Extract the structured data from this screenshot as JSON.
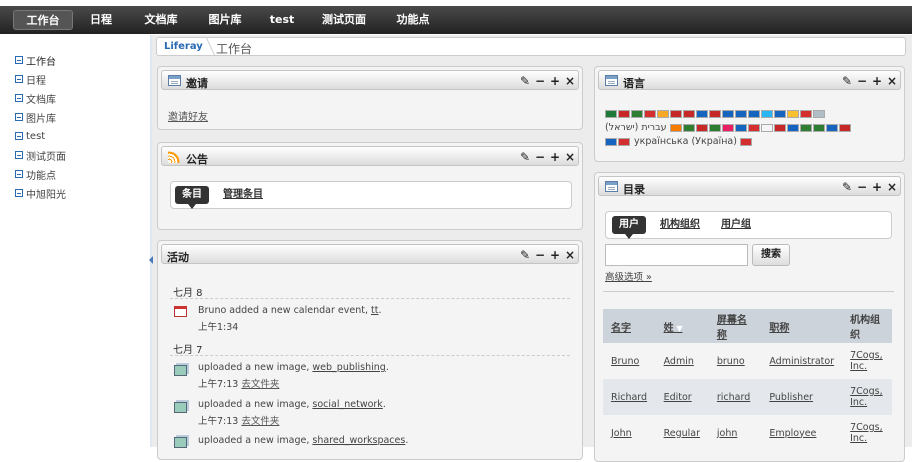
{
  "nav": {
    "items": [
      "工作台",
      "日程",
      "文档库",
      "图片库",
      "test",
      "测试页面",
      "功能点"
    ],
    "active": "工作台"
  },
  "sidebar": {
    "items": [
      "工作台",
      "日程",
      "文档库",
      "图片库",
      "test",
      "测试页面",
      "功能点",
      "中旭阳光"
    ]
  },
  "breadcrumb": {
    "root": "Liferay",
    "current": "工作台"
  },
  "portlet_buttons": {
    "configure": "⚙",
    "minimize": "−",
    "maximize": "+",
    "close": "×"
  },
  "invite": {
    "title": "邀请",
    "link": "邀请好友"
  },
  "announcements": {
    "title": "公告",
    "tabs": [
      "条目",
      "管理条目"
    ]
  },
  "activities": {
    "title": "活动",
    "groups": [
      {
        "date": "七月 8",
        "entries": [
          {
            "text": "Bruno added a new calendar event, ",
            "link": "tt",
            "suffix": ".",
            "time": "上午1:34",
            "icon": "calendar-icon"
          }
        ]
      },
      {
        "date": "七月 7",
        "entries": [
          {
            "text": "uploaded a new image, ",
            "link": "web_publishing",
            "suffix": ".",
            "time": "上午7:13",
            "folder": "去文件夹",
            "icon": "image-icon"
          },
          {
            "text": "uploaded a new image, ",
            "link": "social_network",
            "suffix": ".",
            "time": "上午7:13",
            "folder": "去文件夹",
            "icon": "image-icon"
          },
          {
            "text": "uploaded a new image, ",
            "link": "shared_workspaces",
            "suffix": ".",
            "time": "",
            "folder": "",
            "icon": "image-icon"
          }
        ]
      }
    ]
  },
  "language": {
    "title": "语言",
    "hebrew": "עברית (ישראל)",
    "ukrainian": "українська (Україна)",
    "flag_colors_row1": [
      "#1f7a3a",
      "#c62828",
      "#2e7d32",
      "#d32f2f",
      "#f9a825",
      "#c62828",
      "#c62828",
      "#1565c0",
      "#c62828",
      "#1565c0",
      "#1565c0",
      "#1565c0",
      "#29b6f6",
      "#1565c0",
      "#fbc02d",
      "#d32f2f",
      "#b0bec5"
    ],
    "flag_colors_row2": [
      "#f57c00",
      "#2e7d32",
      "#c62828",
      "#2e7d32",
      "#e91e63",
      "#1565c0",
      "#d32f2f",
      "#f5f5f5",
      "#c62828",
      "#1565c0",
      "#2e7d32",
      "#2e7d32",
      "#1565c0",
      "#c62828"
    ],
    "flag_colors_row3": [
      "#1565c0",
      "#d32f2f",
      "#d32f2f"
    ]
  },
  "directory": {
    "title": "目录",
    "tabs": [
      "用户",
      "机构组织",
      "用户组"
    ],
    "search_button": "搜索",
    "advanced": "高级选项 »",
    "columns": [
      "名字",
      "姓",
      "屏幕名称",
      "职称",
      "机构组织"
    ],
    "rows": [
      [
        "Bruno",
        "Admin",
        "bruno",
        "Administrator",
        "7Cogs, Inc."
      ],
      [
        "Richard",
        "Editor",
        "richard",
        "Publisher",
        "7Cogs, Inc."
      ],
      [
        "John",
        "Regular",
        "john",
        "Employee",
        "7Cogs, Inc."
      ]
    ]
  }
}
